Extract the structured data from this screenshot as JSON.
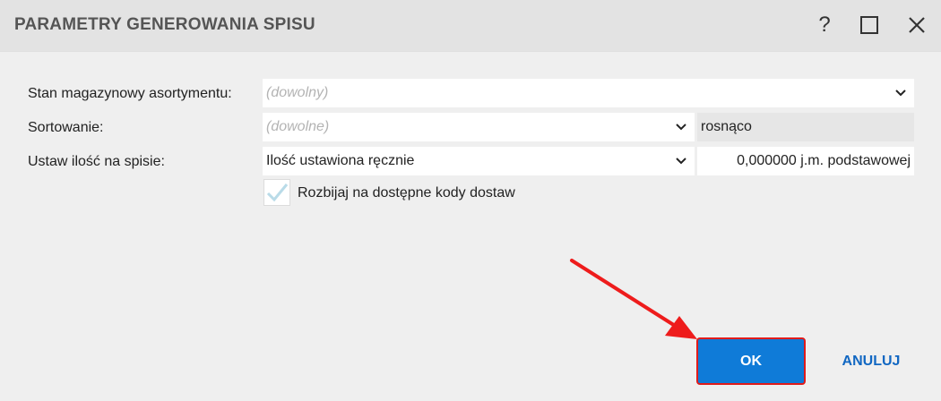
{
  "window": {
    "title": "PARAMETRY GENEROWANIA SPISU",
    "help_label": "?"
  },
  "form": {
    "stock": {
      "label": "Stan magazynowy asortymentu:",
      "placeholder": "(dowolny)"
    },
    "sort": {
      "label": "Sortowanie:",
      "placeholder": "(dowolne)",
      "order_value": "rosnąco"
    },
    "quantity": {
      "label": "Ustaw ilość na spisie:",
      "value": "Ilość ustawiona ręcznie",
      "amount_value": "0,000000 j.m. podstawowej"
    },
    "split": {
      "label": "Rozbijaj na dostępne kody dostaw",
      "checked": true
    }
  },
  "buttons": {
    "ok_label": "OK",
    "cancel_label": "ANULUJ"
  },
  "colors": {
    "primary": "#0f7bd8",
    "highlight": "#e01b1b",
    "link": "#1167c2"
  },
  "icons": {
    "help": "help-icon",
    "maximize": "maximize-icon",
    "close": "close-icon",
    "dropdown": "chevron-down-icon",
    "check": "checkmark-icon"
  }
}
